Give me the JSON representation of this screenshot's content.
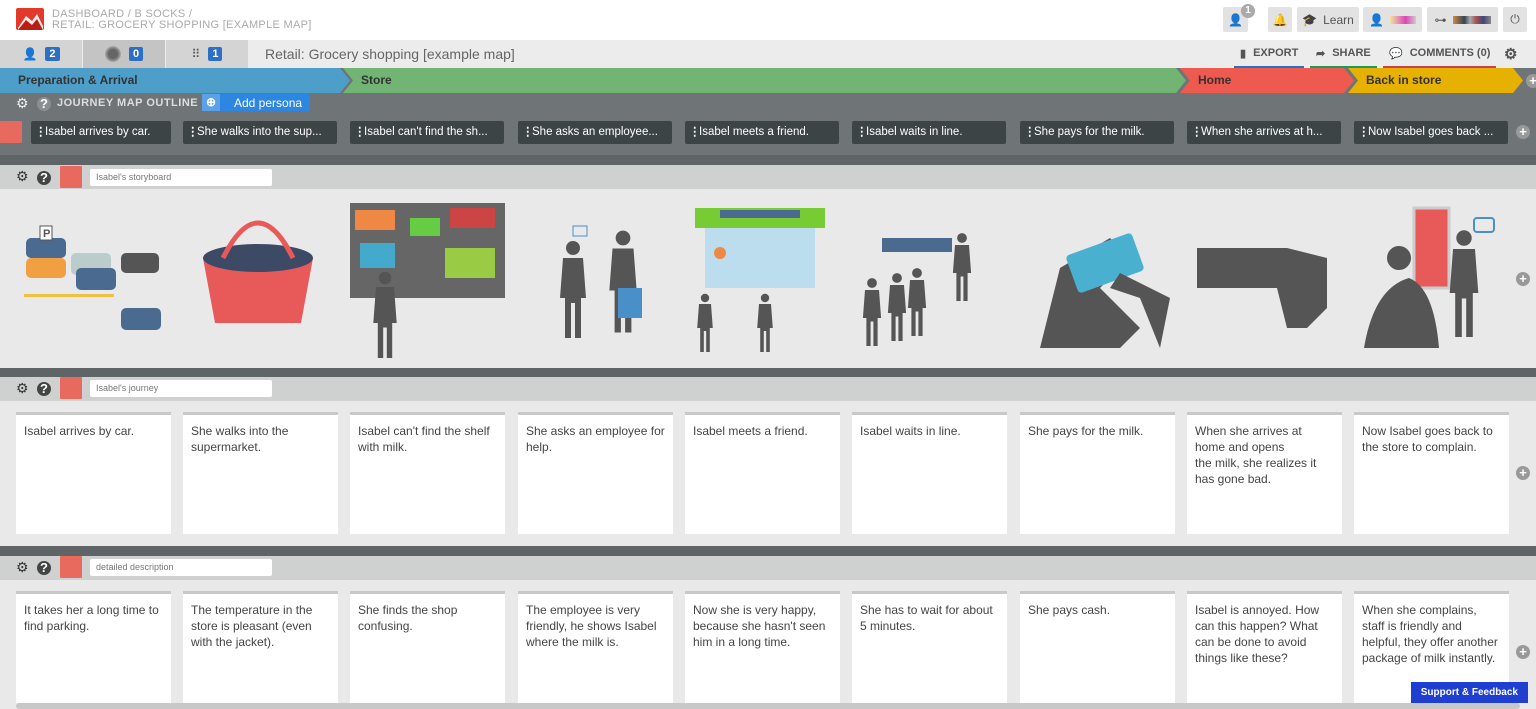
{
  "header": {
    "breadcrumb": [
      "DASHBOARD",
      "B SOCKS"
    ],
    "breadcrumb_sep": "/",
    "current": "RETAIL: GROCERY SHOPPING [EXAMPLE MAP]",
    "notification_count": "1",
    "learn_label": "Learn"
  },
  "tabs": {
    "personas_count": "2",
    "touchpoints_count": "0",
    "structure_count": "1",
    "map_title": "Retail: Grocery shopping [example map]",
    "export": "EXPORT",
    "share": "SHARE",
    "comments": "COMMENTS (0)"
  },
  "phases": [
    {
      "label": "Preparation & Arrival",
      "color": "#4d9fca"
    },
    {
      "label": "Store",
      "color": "#72b473"
    },
    {
      "label": "Home",
      "color": "#ef5a50"
    },
    {
      "label": "Back in store",
      "color": "#e6b100"
    }
  ],
  "outline": {
    "title": "JOURNEY MAP OUTLINE",
    "add_persona": "Add persona",
    "steps": [
      "Isabel arrives by car.",
      "She walks into the sup...",
      "Isabel can't find the sh...",
      "She asks an employee...",
      "Isabel meets a friend.",
      "Isabel waits in line.",
      "She pays for the milk.",
      "When she arrives at h...",
      "Now Isabel goes back ..."
    ]
  },
  "lanes": [
    {
      "name": "Isabel's storyboard",
      "type": "images",
      "images": [
        "cars-parking",
        "shopping-basket",
        "shelves-shopper",
        "asking-employee",
        "supermarket-front",
        "queue-checkout",
        "paying-card",
        "thumbs-down",
        "complaining-at-door"
      ]
    },
    {
      "name": "Isabel's journey",
      "cards": [
        "Isabel arrives by car.",
        "She walks into the supermarket.",
        "Isabel can't find the shelf with milk.",
        "She asks an employee for help.",
        "Isabel meets a friend.",
        "Isabel waits in line.",
        "She pays for the milk.",
        "When she arrives at home and opens\nthe milk, she realizes it has gone bad.",
        "Now Isabel goes back to the store to complain."
      ]
    },
    {
      "name": "detailed description",
      "cards": [
        "It takes her a long time to find parking.",
        "The temperature in the store is pleasant (even with the jacket).",
        "She finds the shop confusing.",
        "The employee is very friendly, he shows Isabel where the milk is.",
        "Now she is very happy, because she hasn't seen him in a long time.",
        "She has to wait for about 5 minutes.",
        "She pays cash.",
        "Isabel is annoyed. How can this happen? What can be done to avoid things like these?",
        "When she complains, staff is friendly and helpful, they offer another package of milk instantly."
      ]
    }
  ],
  "support": "Support & Feedback"
}
